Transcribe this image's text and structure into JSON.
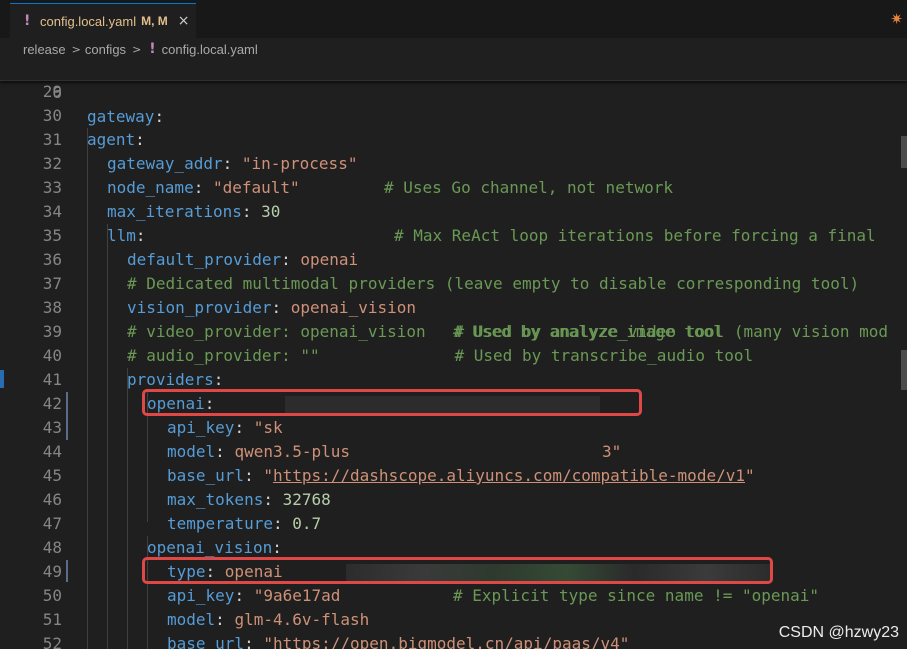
{
  "tab": {
    "modified_icon": "!",
    "filename": "config.local.yaml",
    "status": "M, M",
    "close_icon": "×"
  },
  "corner_icon": "✷",
  "breadcrumb": {
    "part1": "release",
    "part2": "configs",
    "part3": "config.local.yaml"
  },
  "sticky": {
    "num": "6",
    "key": "gateway",
    "colon": ":"
  },
  "lines": {
    "l29": {
      "num": "29"
    },
    "l30": {
      "num": "30",
      "key": "agent",
      "colon": ":"
    },
    "l31": {
      "num": "31",
      "key": "gateway_addr",
      "colon": ": ",
      "val": "\"in-process\"",
      "comment": "# Uses Go channel, not network"
    },
    "l32": {
      "num": "32",
      "key": "node_name",
      "colon": ": ",
      "val": "\"default\""
    },
    "l33": {
      "num": "33",
      "key": "max_iterations",
      "colon": ": ",
      "val": "30",
      "comment": "# Max ReAct loop iterations before forcing a final"
    },
    "l34": {
      "num": "34",
      "key": "llm",
      "colon": ":"
    },
    "l35": {
      "num": "35",
      "key": "default_provider",
      "colon": ": ",
      "val": "openai"
    },
    "l36": {
      "num": "36",
      "comment": "# Dedicated multimodal providers (leave empty to disable corresponding tool)"
    },
    "l37": {
      "num": "37",
      "key": "vision_provider",
      "colon": ": ",
      "val": "openai_vision",
      "comment": "# Used by analyze_image tool"
    },
    "l38": {
      "num": "38",
      "comment": "# video_provider: openai_vision   # Used by analyze_video tool (many vision mod"
    },
    "l39": {
      "num": "39",
      "comment": "# audio_provider: \"\"              # Used by transcribe_audio tool"
    },
    "l40": {
      "num": "40",
      "key": "providers",
      "colon": ":"
    },
    "l41": {
      "num": "41",
      "key": "openai",
      "colon": ":"
    },
    "l42": {
      "num": "42",
      "key": "api_key",
      "colon": ": ",
      "val_start": "\"sk",
      "val_end": "3\""
    },
    "l43": {
      "num": "43",
      "key": "model",
      "colon": ": ",
      "val": "qwen3.5-plus"
    },
    "l44": {
      "num": "44",
      "key": "base_url",
      "colon": ": ",
      "q1": "\"",
      "url": "https://dashscope.aliyuncs.com/compatible-mode/v1",
      "q2": "\""
    },
    "l45": {
      "num": "45",
      "key": "max_tokens",
      "colon": ": ",
      "val": "32768"
    },
    "l46": {
      "num": "46",
      "key": "temperature",
      "colon": ": ",
      "val": "0.7"
    },
    "l47": {
      "num": "47",
      "key": "openai_vision",
      "colon": ":"
    },
    "l48": {
      "num": "48",
      "key": "type",
      "colon": ": ",
      "val": "openai",
      "comment": "# Explicit type since name != \"openai\""
    },
    "l49": {
      "num": "49",
      "key": "api_key",
      "colon": ": ",
      "val_start": "\"9a6e17ad"
    },
    "l50": {
      "num": "50",
      "key": "model",
      "colon": ": ",
      "val": "glm-4.6v-flash"
    },
    "l51": {
      "num": "51",
      "key": "base_url",
      "colon": ": ",
      "q1": "\"",
      "url": "https://open.bigmodel.cn/api/paas/v4",
      "q2": "\""
    },
    "l52": {
      "num": "52",
      "key": "max_tokens",
      "colon": ": ",
      "val": "4096"
    }
  },
  "watermark": "CSDN @hzwy23",
  "colors": {
    "key": "#569cd6",
    "string": "#ce9178",
    "number": "#b5cea8",
    "comment": "#6a9955",
    "highlight": "#e04848",
    "tab_text": "#e2c08d"
  }
}
